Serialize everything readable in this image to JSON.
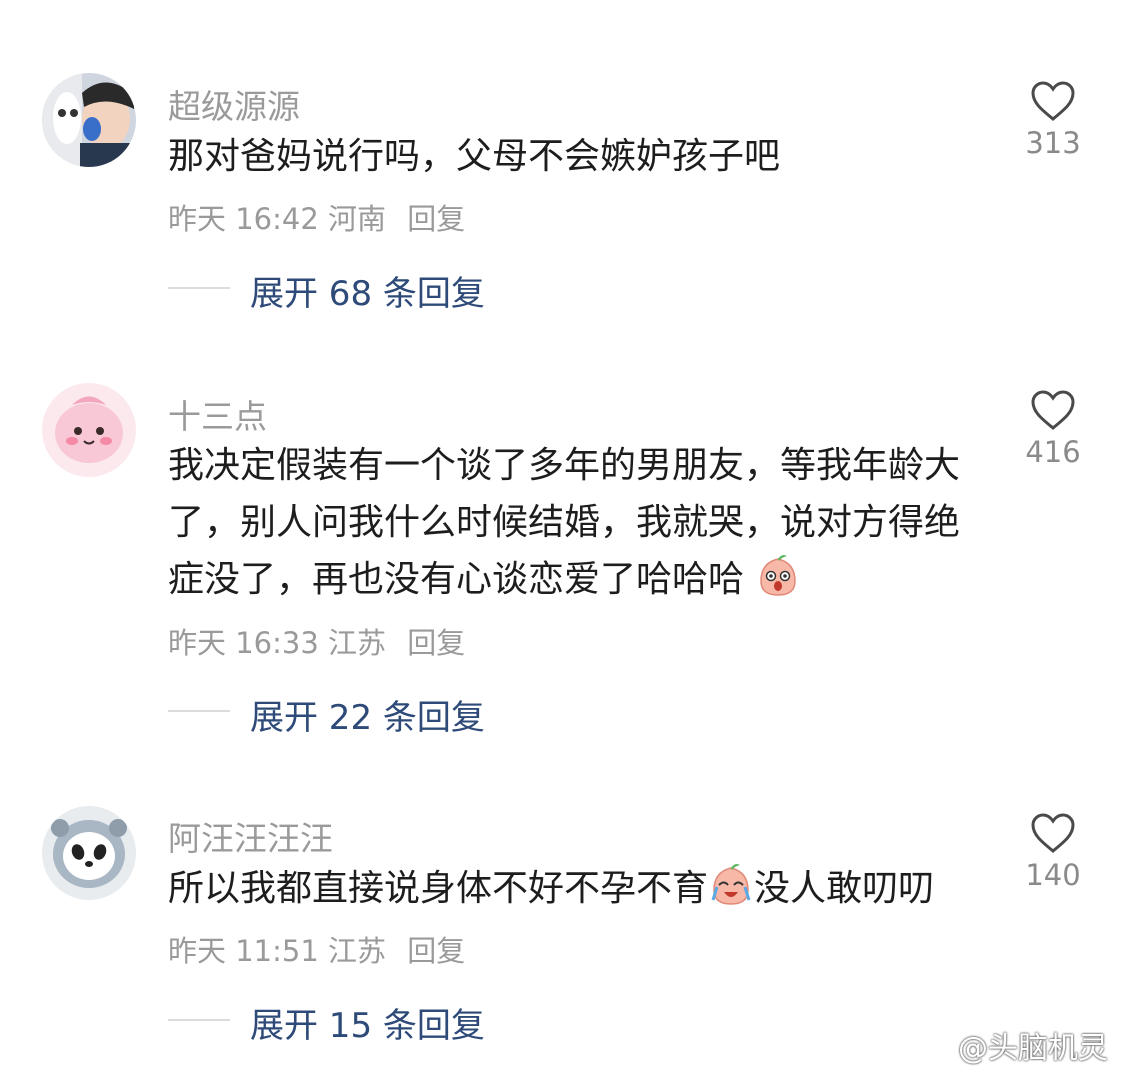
{
  "comments": [
    {
      "username": "超级源源",
      "text": [
        "那对爸妈说行吗，父母不会嫉妒孩子吧"
      ],
      "time": "昨天 16:42 河南",
      "reply": "回复",
      "likes": "313",
      "expand": "展开 68 条回复",
      "avatar_icon": "photo-avatar"
    },
    {
      "username": "十三点",
      "text": [
        "我决定假装有一个谈了多年的男朋友，等我年龄大",
        "了，别人问我什么时候结婚，我就哭，说对方得绝",
        "症没了，再也没有心谈恋爱了哈哈哈"
      ],
      "time": "昨天 16:33 江苏",
      "reply": "回复",
      "likes": "416",
      "expand": "展开 22 条回复",
      "avatar_icon": "pink-cartoon-avatar",
      "trailing_emoji": "surprised-peach-emoji"
    },
    {
      "username": "阿汪汪汪汪",
      "text_before": "所以我都直接说身体不好不孕不育",
      "text_after": "没人敢叨叨",
      "time": "昨天 11:51 江苏",
      "reply": "回复",
      "likes": "140",
      "expand": "展开 15 条回复",
      "avatar_icon": "panda-plush-avatar",
      "inline_emoji": "crying-laugh-peach-emoji"
    }
  ],
  "watermark": "@头脑机灵",
  "colors": {
    "username": "#9a9a9a",
    "body": "#1d1d1d",
    "expand": "#2e4a78",
    "meta": "#9a9a9a"
  }
}
